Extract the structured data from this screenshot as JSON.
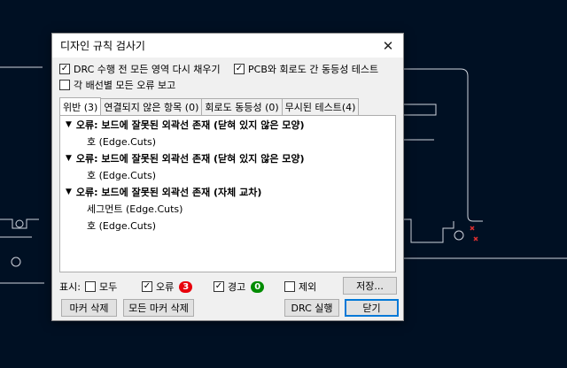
{
  "dialog": {
    "title": "디자인 규칙 검사기",
    "close_glyph": "✕"
  },
  "options": {
    "refill_zones": {
      "label": "DRC 수행 전 모든 영역 다시 채우기",
      "checked": true
    },
    "pcb_schematic_parity": {
      "label": "PCB와 회로도 간 동등성 테스트",
      "checked": true
    },
    "report_all_errors": {
      "label": "각 배선별 모든 오류 보고",
      "checked": false
    }
  },
  "tabs": [
    {
      "label": "위반 (3)",
      "active": true
    },
    {
      "label": "연결되지 않은 항목 (0)",
      "active": false
    },
    {
      "label": "회로도 동등성 (0)",
      "active": false
    },
    {
      "label": "무시된 테스트(4)",
      "active": false
    }
  ],
  "violations": [
    {
      "title": "오류: 보드에 잘못된 외곽선 존재 (닫혀 있지 않은 모양)",
      "items": [
        "호 (Edge.Cuts)"
      ]
    },
    {
      "title": "오류: 보드에 잘못된 외곽선 존재 (닫혀 있지 않은 모양)",
      "items": [
        "호 (Edge.Cuts)"
      ]
    },
    {
      "title": "오류: 보드에 잘못된 외곽선 존재 (자체 교차)",
      "items": [
        "세그먼트 (Edge.Cuts)",
        "호 (Edge.Cuts)"
      ]
    }
  ],
  "filters": {
    "show_label": "표시:",
    "all": {
      "label": "모두",
      "checked": false
    },
    "errors": {
      "label": "오류",
      "checked": true,
      "count": "3",
      "color": "#e8000b"
    },
    "warnings": {
      "label": "경고",
      "checked": true,
      "count": "0",
      "color": "#008c00"
    },
    "excluded": {
      "label": "제외",
      "checked": false
    },
    "save_label": "저장..."
  },
  "buttons": {
    "delete_marker": "마커 삭제",
    "delete_all_markers": "모든 마커 삭제",
    "run_drc": "DRC 실행",
    "close": "닫기"
  },
  "colors": {
    "canvas_background": "#001023",
    "board_outline": "#cfd3dc",
    "accent": "#0078d7"
  }
}
